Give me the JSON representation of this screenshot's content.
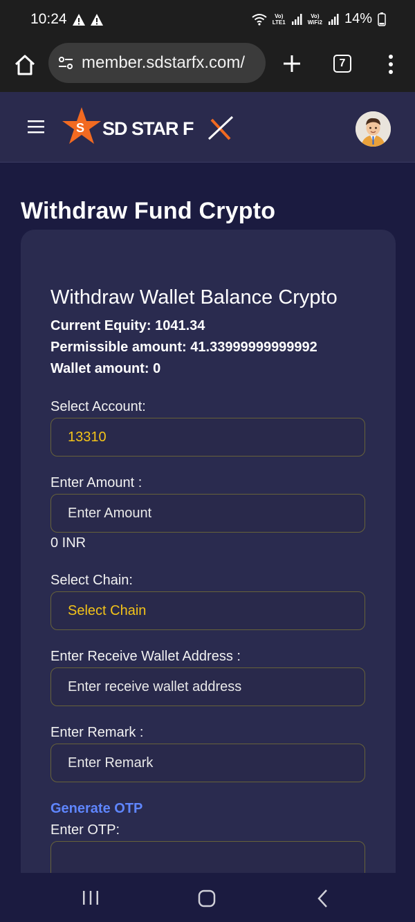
{
  "status_bar": {
    "time": "10:24",
    "net1_top": "Vo)",
    "net1_bottom": "LTE1",
    "net2_top": "Vo)",
    "net2_bottom": "WiFi2",
    "battery": "14%"
  },
  "browser": {
    "url": "member.sdstarfx.com/",
    "tab_count": "7"
  },
  "header": {
    "logo_text": "SD STAR FX"
  },
  "page": {
    "title": "Withdraw Fund Crypto",
    "card_title": "Withdraw Wallet Balance Crypto",
    "current_equity": "Current Equity: 1041.34",
    "permissible_amount": "Permissible amount: 41.33999999999992",
    "wallet_amount": "Wallet amount: 0"
  },
  "form": {
    "account_label": "Select Account:",
    "account_value": "13310",
    "amount_label": "Enter Amount :",
    "amount_placeholder": "Enter Amount",
    "amount_conversion": "0 INR",
    "chain_label": "Select Chain:",
    "chain_value": "Select Chain",
    "wallet_label": "Enter Receive Wallet Address :",
    "wallet_placeholder": "Enter receive wallet address",
    "remark_label": "Enter Remark :",
    "remark_placeholder": "Enter Remark",
    "generate_otp": "Generate OTP",
    "otp_label": "Enter OTP:",
    "otp_value": ""
  },
  "colors": {
    "page_bg": "#1b1b40",
    "card_bg": "#2a2b4f",
    "accent_yellow": "#f3c319",
    "link_blue": "#5f86ff",
    "logo_orange": "#f26a21"
  }
}
